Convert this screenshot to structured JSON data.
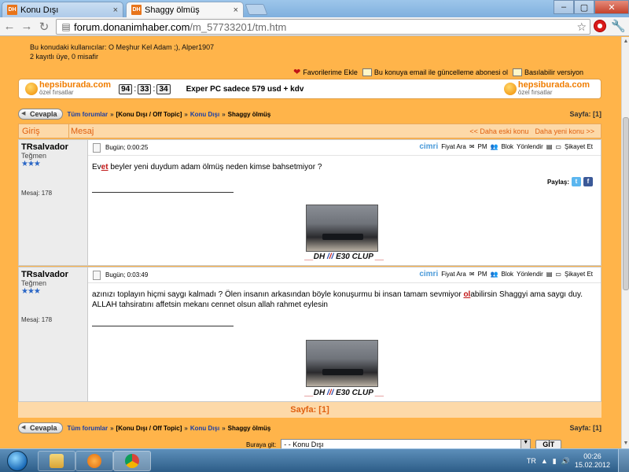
{
  "browser": {
    "tabs": [
      {
        "label": "Konu Dışı",
        "favicon": "DH"
      },
      {
        "label": "Shaggy ölmüş",
        "favicon": "DH"
      }
    ],
    "url_host": "forum.donanimhaber.com",
    "url_path": "/m_57733201/tm.htm",
    "min": "–",
    "max": "▢",
    "close": "✕"
  },
  "forum": {
    "users_line1": "Bu konudaki kullanıcılar: O Meşhur Kel Adam ;), Alper1907",
    "users_line2": "2 kayıtlı üye, 0 misafir",
    "actions": {
      "favorites": "Favorilerime Ekle",
      "subscribe": "Bu konuya email ile güncelleme abonesi ol",
      "print": "Basılabilir versiyon"
    },
    "banner": {
      "brand": "hepsiburada.com",
      "sub": "özel fırsatlar",
      "clock": [
        "94",
        "33",
        "34"
      ],
      "promo": "Exper PC sadece 579 usd + kdv"
    },
    "crumbs": {
      "reply": "Cevapla",
      "all": "Tüm forumlar",
      "cat": "[Konu Dışı / Off Topic]",
      "sub": "Konu Dışı",
      "topic": "Shaggy ölmüş",
      "pages_label": "Sayfa:",
      "pages_value": "[1]"
    },
    "table": {
      "h_login": "Giriş",
      "h_message": "Mesaj",
      "older": "<< Daha eski konu",
      "newer": "Daha yeni konu >>"
    },
    "tools": {
      "cimri": "cimri",
      "price": "Fiyat Ara",
      "pm": "PM",
      "block": "Blok",
      "redirect": "Yönlendir",
      "complain": "Şikayet Et"
    },
    "share_label": "Paylaş:",
    "posts": [
      {
        "author": "TRsalvador",
        "rank": "Teğmen",
        "stars": "★★★",
        "count": "Mesaj: 178",
        "time": "Bugün; 0:00:25",
        "text_pre": "Ev",
        "text_u": "et",
        "text_post": " beyler yeni duydum adam ölmüş neden kimse bahsetmiyor ?"
      },
      {
        "author": "TRsalvador",
        "rank": "Teğmen",
        "stars": "★★★",
        "count": "Mesaj: 178",
        "time": "Bugün; 0:03:49",
        "text_pre": "azınızı toplayın hiçmi saygı kalmadı ? Ölen insanın arkasından böyle konuşurmu bi insan tamam sevmiyor ",
        "text_u": "ol",
        "text_post": "abilirsin Shaggyi ama saygı duy. ALLAH tahsiratını affetsin mekanı cennet olsun allah rahmet eylesin"
      }
    ],
    "sig": {
      "lead": "__",
      "dh": "DH ",
      "s1": "/",
      "s2": "/",
      "s3": "/",
      "e30": " E30 CLUP ",
      "tail": "__"
    },
    "pagesbar": "Sayfa:   [1]",
    "goto_label": "Buraya git:",
    "goto_value": "- - Konu Dışı",
    "goto_btn": "GİT"
  },
  "taskbar": {
    "lang": "TR",
    "time": "00:26",
    "date": "15.02.2012"
  }
}
